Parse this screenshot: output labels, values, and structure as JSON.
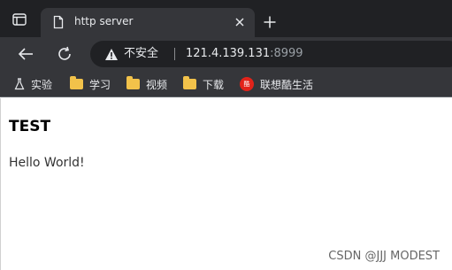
{
  "tab": {
    "title": "http server"
  },
  "toolbar": {
    "security_label": "不安全",
    "url_host": "121.4.139.131",
    "url_port": ":8999"
  },
  "bookmarks": [
    {
      "label": "实验",
      "icon": "flask-icon"
    },
    {
      "label": "学习",
      "icon": "folder-icon"
    },
    {
      "label": "视频",
      "icon": "folder-icon"
    },
    {
      "label": "下载",
      "icon": "folder-icon"
    },
    {
      "label": "联想酷生活",
      "icon": "lenovo-icon"
    }
  ],
  "page": {
    "heading": "TEST",
    "paragraph": "Hello World!"
  },
  "watermark": "CSDN @JJJ MODEST",
  "colors": {
    "frame": "#202124",
    "toolbar": "#35363a",
    "text_light": "#e8eaed",
    "folder": "#f2c24a"
  }
}
